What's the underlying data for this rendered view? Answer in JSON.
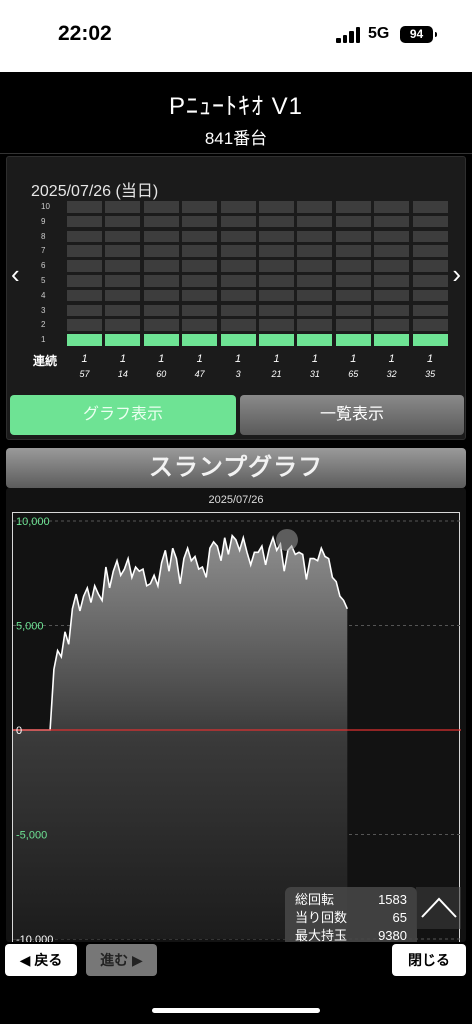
{
  "status_bar": {
    "time": "22:02",
    "network": "5G",
    "battery": "94"
  },
  "header": {
    "machine_name": "Pﾆｭｰﾄｷｵ V1",
    "machine_number": "841番台"
  },
  "history": {
    "date": "2025/07/26 (当日)",
    "row_labels": [
      "10",
      "9",
      "8",
      "7",
      "6",
      "5",
      "4",
      "3",
      "2",
      "1"
    ],
    "renzoku_label": "連続",
    "columns": [
      {
        "renzoku": "1",
        "games": "57"
      },
      {
        "renzoku": "1",
        "games": "14"
      },
      {
        "renzoku": "1",
        "games": "60"
      },
      {
        "renzoku": "1",
        "games": "47"
      },
      {
        "renzoku": "1",
        "games": "3"
      },
      {
        "renzoku": "1",
        "games": "21"
      },
      {
        "renzoku": "1",
        "games": "31"
      },
      {
        "renzoku": "1",
        "games": "65"
      },
      {
        "renzoku": "1",
        "games": "32"
      },
      {
        "renzoku": "1",
        "games": "35"
      }
    ],
    "tab_graph": "グラフ表示",
    "tab_list": "一覧表示"
  },
  "slump": {
    "title": "スランプグラフ",
    "date": "2025/07/26",
    "y_ticks": [
      "10,000",
      "5,000",
      "0",
      "-5,000",
      "-10,000"
    ]
  },
  "chart_data": {
    "type": "area",
    "title": "スランプグラフ",
    "subtitle": "2025/07/26",
    "ylim": [
      -10000,
      10000
    ],
    "y_ticks": [
      10000,
      5000,
      0,
      -5000,
      -10000
    ],
    "xlim": [
      0,
      1583
    ],
    "series": [
      {
        "x": [
          0,
          150,
          165,
          180,
          195,
          210,
          225,
          240,
          255,
          270,
          285,
          300,
          315,
          330,
          345,
          360,
          375,
          390,
          405,
          420,
          435,
          450,
          465,
          480,
          495,
          510,
          525,
          540,
          555,
          570,
          585,
          600,
          615,
          630,
          645,
          660,
          675,
          690,
          705,
          720,
          735,
          750,
          765,
          780,
          795,
          810,
          825,
          840,
          855,
          870,
          885,
          900,
          915,
          930,
          945,
          960,
          975,
          990,
          1005,
          1020,
          1035,
          1050,
          1065,
          1080,
          1095,
          1110,
          1125,
          1140,
          1155,
          1170,
          1185,
          1200,
          1215,
          1230,
          1245,
          1260,
          1275,
          1290,
          1305,
          1320,
          1335,
          1350
        ],
        "values": [
          0,
          0,
          2900,
          3800,
          3500,
          4700,
          4100,
          5800,
          6500,
          5700,
          6400,
          6800,
          6100,
          6900,
          6500,
          6200,
          7800,
          6800,
          7600,
          8100,
          7400,
          7700,
          8200,
          7300,
          7800,
          7600,
          7700,
          6900,
          7000,
          7400,
          6900,
          8000,
          8600,
          7600,
          8700,
          8200,
          7000,
          8200,
          8700,
          8100,
          8300,
          7700,
          7800,
          7300,
          8700,
          9000,
          8800,
          8100,
          9200,
          8400,
          9300,
          9100,
          8600,
          9200,
          8500,
          7900,
          8500,
          8500,
          8800,
          7900,
          8700,
          9200,
          8600,
          8900,
          7600,
          8600,
          8800,
          8400,
          8500,
          8400,
          7200,
          8200,
          8200,
          8100,
          8700,
          8300,
          8200,
          7300,
          7100,
          6400,
          6200,
          5800
        ]
      }
    ],
    "grid": true
  },
  "stats": [
    {
      "label": "総回転",
      "value": "1583"
    },
    {
      "label": "当り回数",
      "value": "65"
    },
    {
      "label": "最大持玉",
      "value": "9380"
    }
  ],
  "buttons": {
    "back": "◀ 戻る",
    "forward": "進む ▶",
    "close": "閉じる"
  },
  "colors": {
    "accent_green": "#6ee394",
    "zero_line": "#e03030"
  }
}
